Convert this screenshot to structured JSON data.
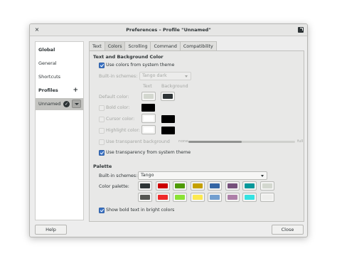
{
  "window": {
    "title": "Preferences – Profile \"Unnamed\"",
    "close_glyph": "×"
  },
  "sidebar": {
    "global": "Global",
    "general": "General",
    "shortcuts": "Shortcuts",
    "profiles": "Profiles",
    "add_glyph": "+",
    "selected_profile": "Unnamed",
    "check_glyph": "✓"
  },
  "tabs": [
    "Text",
    "Colors",
    "Scrolling",
    "Command",
    "Compatibility"
  ],
  "active_tab": "Colors",
  "text_bg": {
    "section_title": "Text and Background Color",
    "use_system_colors": "Use colors from system theme",
    "use_system_colors_checked": true,
    "builtin_label": "Built-in schemes:",
    "builtin_value": "Tango dark",
    "col_text": "Text",
    "col_background": "Background",
    "default_color": "Default color:",
    "default_text_color": "#d3d7cf",
    "default_bg_color": "#2e3436",
    "bold_color": "Bold color:",
    "bold_color_checked": false,
    "bold_color_value": "#000000",
    "cursor_color": "Cursor color:",
    "cursor_color_checked": false,
    "cursor_text_color": "#ffffff",
    "cursor_bg_color": "#000000",
    "highlight_color": "Highlight color:",
    "highlight_color_checked": false,
    "highlight_text_color": "#ffffff",
    "highlight_bg_color": "#000000",
    "transparent_bg": "Use transparent background",
    "transparent_bg_checked": false,
    "slider_none": "none",
    "slider_full": "full",
    "slider_level": 0.5,
    "system_transparency": "Use transparency from system theme",
    "system_transparency_checked": true
  },
  "palette": {
    "section_title": "Palette",
    "builtin_label": "Built-in schemes:",
    "builtin_value": "Tango",
    "color_palette_label": "Color palette:",
    "row1": [
      "#2e3436",
      "#cc0000",
      "#4e9a06",
      "#c4a000",
      "#3465a4",
      "#75507b",
      "#06989a",
      "#d3d7cf"
    ],
    "row2": [
      "#555753",
      "#ef2929",
      "#8ae234",
      "#fce94f",
      "#729fcf",
      "#ad7fa8",
      "#34e2e2",
      "#eeeeec"
    ],
    "bold_bright": "Show bold text in bright colors",
    "bold_bright_checked": true
  },
  "footer": {
    "help": "Help",
    "close": "Close"
  }
}
